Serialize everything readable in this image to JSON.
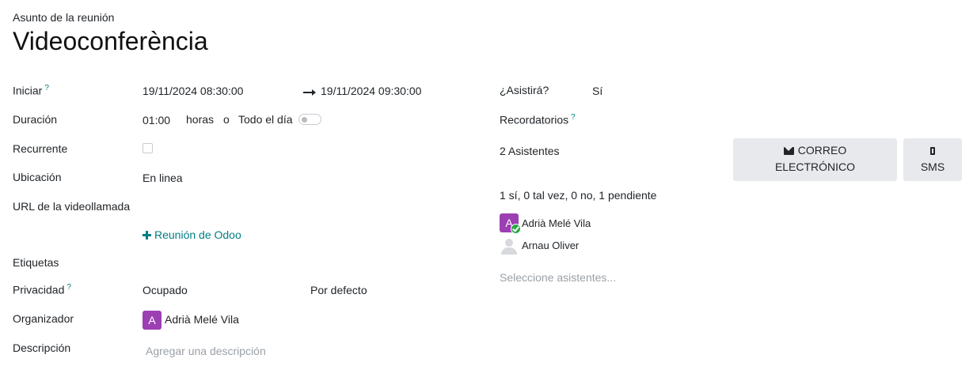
{
  "header": {
    "subject_label": "Asunto de la reunión",
    "title": "Videoconferència"
  },
  "left": {
    "start": {
      "label": "Iniciar",
      "help": "?",
      "from": "19/11/2024 08:30:00",
      "to": "19/11/2024 09:30:00"
    },
    "duration": {
      "label": "Duración",
      "value": "01:00",
      "unit": "horas",
      "or": "o",
      "all_day_label": "Todo el día",
      "all_day_on": false
    },
    "recurrent": {
      "label": "Recurrente",
      "checked": false
    },
    "location": {
      "label": "Ubicación",
      "value": "En linea"
    },
    "video_url": {
      "label": "URL de la videollamada",
      "link": "Reunión de Odoo"
    },
    "tags": {
      "label": "Etiquetas"
    },
    "privacy": {
      "label": "Privacidad",
      "help": "?",
      "value": "Ocupado",
      "value2": "Por defecto"
    },
    "organizer": {
      "label": "Organizador",
      "avatar_letter": "A",
      "name": "Adrià Melé Vila"
    },
    "description": {
      "label": "Descripción",
      "placeholder": "Agregar una descripción"
    }
  },
  "right": {
    "attend": {
      "label": "¿Asistirá?",
      "value": "Sí"
    },
    "reminders": {
      "label": "Recordatorios",
      "help": "?"
    },
    "attendees": {
      "count_label": "2 Asistentes",
      "summary": "1 sí, 0 tal vez, 0 no, 1 pendiente",
      "list": [
        {
          "name": "Adrià Melé Vila",
          "avatar_letter": "A",
          "status": "accepted"
        },
        {
          "name": "Arnau Oliver",
          "avatar_letter": "",
          "status": "pending"
        }
      ],
      "select_placeholder": "Seleccione asistentes..."
    },
    "email_button": {
      "line1": "CORREO",
      "line2": "ELECTRÓNICO",
      "icon": "envelope-icon"
    },
    "sms_button": {
      "label": "SMS",
      "icon": "mobile-phone-icon"
    }
  },
  "colors": {
    "accent": "#017e84",
    "avatar": "#9c3fb3",
    "button_bg": "#e7e9ed",
    "success": "#28a745"
  }
}
